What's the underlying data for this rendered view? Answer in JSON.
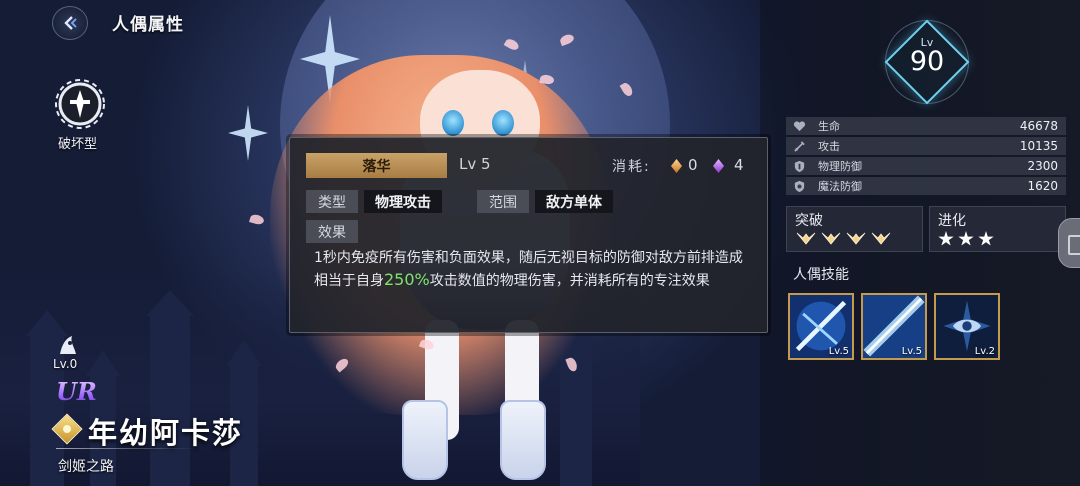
{
  "header": {
    "title": "人偶属性"
  },
  "character": {
    "class_label": "破坏型",
    "bond_level": "Lv.0",
    "rarity": "UR",
    "name": "年幼阿卡莎",
    "subtitle": "剑姬之路",
    "level_label": "Lv",
    "level": "90"
  },
  "skill_popup": {
    "name": "落华",
    "level": "Lv 5",
    "cost_label": "消耗:",
    "cost_orange": "0",
    "cost_purple": "4",
    "type_key": "类型",
    "type_value": "物理攻击",
    "range_key": "范围",
    "range_value": "敌方单体",
    "effect_key": "效果",
    "desc_before": "1秒内免疫所有伤害和负面效果，随后无视目标的防御对敌方前排造成相当于自身",
    "desc_highlight": "250%",
    "desc_after": "攻击数值的物理伤害，并消耗所有的专注效果",
    "highlight_color": "#7fe36c"
  },
  "stats": [
    {
      "icon": "heart-icon",
      "label": "生命",
      "value": "46678"
    },
    {
      "icon": "sword-icon",
      "label": "攻击",
      "value": "10135"
    },
    {
      "icon": "shield-icon",
      "label": "物理防御",
      "value": "2300"
    },
    {
      "icon": "magic-shield-icon",
      "label": "魔法防御",
      "value": "1620"
    }
  ],
  "breakthrough": {
    "title": "突破",
    "count": 4
  },
  "evolution": {
    "title": "进化",
    "stars": 3
  },
  "skills_title": "人偶技能",
  "skills": [
    {
      "icon": "sword-slash-icon",
      "level": "Lv.5"
    },
    {
      "icon": "blade-beam-icon",
      "level": "Lv.5"
    },
    {
      "icon": "eye-crest-icon",
      "level": "Lv.2"
    }
  ]
}
